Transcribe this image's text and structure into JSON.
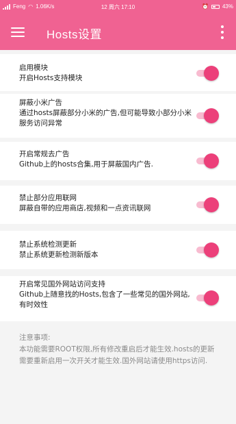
{
  "status_bar": {
    "carrier": "Feng",
    "speed": "1.06K/s",
    "datetime": "12 周六 17:10",
    "battery": "43%"
  },
  "app_bar": {
    "title": "Hosts设置",
    "menu_icon": "hamburger-menu-icon",
    "more_icon": "more-vert-icon"
  },
  "settings": [
    {
      "title": "启用模块",
      "desc": "开启Hosts支持模块",
      "enabled": true
    },
    {
      "title": "屏蔽小米广告",
      "desc": "通过hosts屏蔽部分小米的广告,但可能导致小部分小米服务访问异常",
      "enabled": true
    },
    {
      "title": "开启常规去广告",
      "desc": "Github上的hosts合集,用于屏蔽国内广告.",
      "enabled": true
    },
    {
      "title": "禁止部分应用联网",
      "desc": "屏蔽自带的应用商店,视频和一点资讯联网",
      "enabled": true
    },
    {
      "title": "禁止系统检测更新",
      "desc": "禁止系统更新检测新版本",
      "enabled": true
    },
    {
      "title": "开启常见国外网站访问支持",
      "desc": "Github上随意找的Hosts,包含了一些常见的国外网站,有时效性",
      "enabled": true
    }
  ],
  "notes": {
    "heading": "注意事项:",
    "text": "本功能需要ROOT权限,所有修改重启后才能生效.hosts的更新需要重新启用一次开关才能生效.国外网站请使用https访问."
  },
  "colors": {
    "accent": "#f06292",
    "toggle_thumb": "#ec407a",
    "toggle_track": "#f8bbd0"
  }
}
